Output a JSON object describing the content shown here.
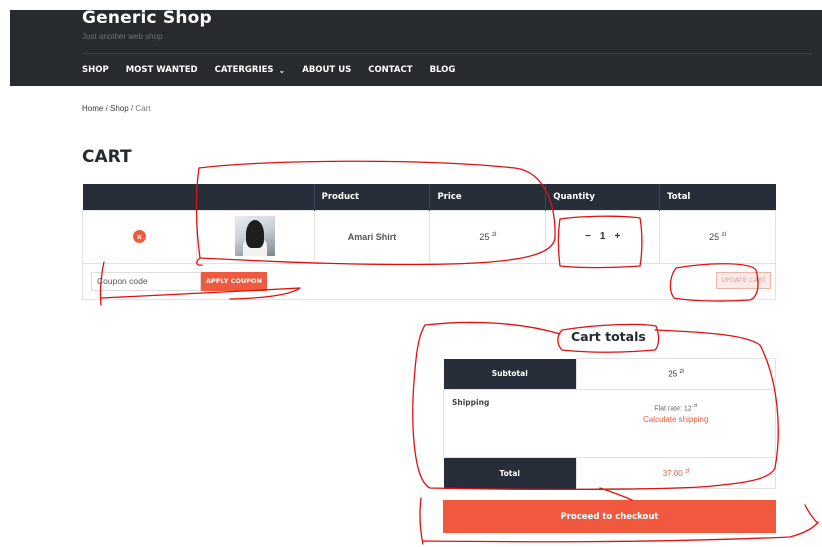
{
  "site": {
    "title": "Generic Shop",
    "tagline": "Just another web shop"
  },
  "nav": {
    "items": [
      {
        "label": "SHOP"
      },
      {
        "label": "MOST WANTED"
      },
      {
        "label": "CATERGRIES"
      },
      {
        "label": "ABOUT US"
      },
      {
        "label": "CONTACT"
      },
      {
        "label": "BLOG"
      }
    ]
  },
  "breadcrumb": {
    "home": "Home",
    "sep": " / ",
    "shop": "Shop",
    "current": "Cart"
  },
  "page_title": "CART",
  "cart_table": {
    "headers": [
      "Product",
      "Price",
      "Quantity",
      "Total"
    ],
    "rows": [
      {
        "name": "Amari Shirt",
        "price": "25",
        "currency": "zł",
        "qty": "1",
        "total": "25"
      }
    ],
    "remove_symbol": "×",
    "qty_minus": "−",
    "qty_plus": "+"
  },
  "coupon": {
    "placeholder": "Coupon code",
    "apply_label": "APPLY COUPON",
    "update_label": "UPDATE CART"
  },
  "totals": {
    "title": "Cart totals",
    "subtotal_label": "Subtotal",
    "subtotal_value": "25",
    "shipping_label": "Shipping",
    "shipping_rate": "Flat rate: 12",
    "calc_shipping": "Calculate shipping",
    "total_label": "Total",
    "total_value": "37.00",
    "currency": "zł"
  },
  "checkout_label": "Proceed to checkout",
  "colors": {
    "accent": "#f0593e",
    "header_bg": "#272a2f",
    "table_header": "#272e3a",
    "annotation": "#e01010"
  }
}
